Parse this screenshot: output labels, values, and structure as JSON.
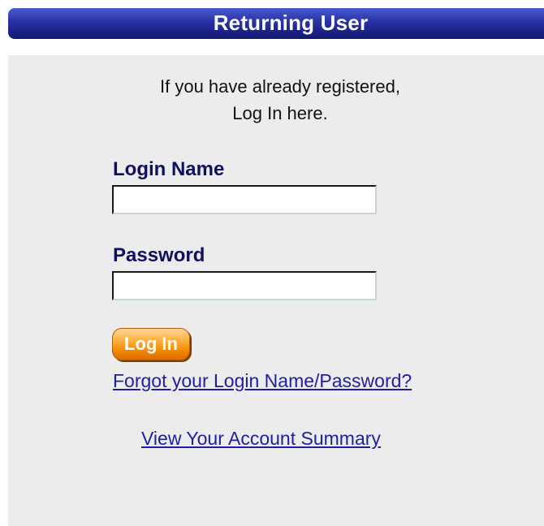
{
  "header": {
    "title": "Returning User"
  },
  "intro": {
    "line1": "If you have already registered,",
    "line2": "Log In here."
  },
  "form": {
    "login_name_label": "Login Name",
    "login_name_value": "",
    "password_label": "Password",
    "password_value": "",
    "submit_label": "Log In"
  },
  "links": {
    "forgot": "Forgot your Login Name/Password?",
    "account_summary": "View Your Account Summary"
  },
  "colors": {
    "header_bar": "#1c2388",
    "panel_background": "#ececec",
    "label_text": "#101060",
    "link_text": "#1f1f9f",
    "button_orange": "#f28a00"
  }
}
